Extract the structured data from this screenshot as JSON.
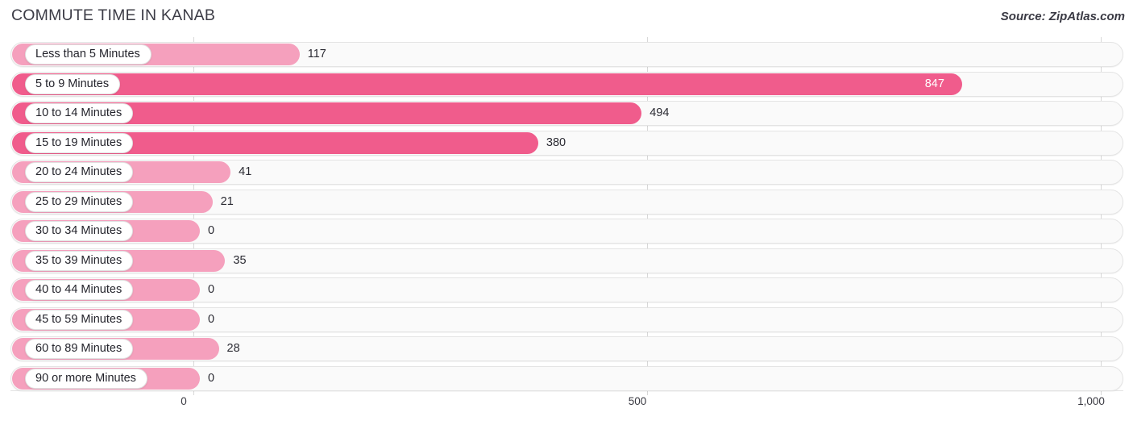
{
  "header": {
    "title": "COMMUTE TIME IN KANAB",
    "source": "Source: ZipAtlas.com"
  },
  "axis": {
    "ticks": [
      "0",
      "500",
      "1,000"
    ]
  },
  "colors": {
    "bar_light": "#f5a0bd",
    "bar_strong": "#f05c8c",
    "track": "#fafafa",
    "gridline": "#d8d8d8",
    "title_text": "#3c3c46"
  },
  "chart_data": {
    "type": "bar",
    "orientation": "horizontal",
    "title": "COMMUTE TIME IN KANAB",
    "xlabel": "",
    "ylabel": "",
    "xlim": [
      0,
      1000
    ],
    "xticks": [
      0,
      500,
      1000
    ],
    "grid": true,
    "legend": "none",
    "categories": [
      "Less than 5 Minutes",
      "5 to 9 Minutes",
      "10 to 14 Minutes",
      "15 to 19 Minutes",
      "20 to 24 Minutes",
      "25 to 29 Minutes",
      "30 to 34 Minutes",
      "35 to 39 Minutes",
      "40 to 44 Minutes",
      "45 to 59 Minutes",
      "60 to 89 Minutes",
      "90 or more Minutes"
    ],
    "values": [
      117,
      847,
      494,
      380,
      41,
      21,
      0,
      35,
      0,
      0,
      28,
      0
    ],
    "value_labels": [
      "117",
      "847",
      "494",
      "380",
      "41",
      "21",
      "0",
      "35",
      "0",
      "0",
      "28",
      "0"
    ]
  },
  "rows": [
    {
      "label": "Less than 5 Minutes",
      "value": 117,
      "value_label": "117",
      "tone": "light",
      "label_inside": false
    },
    {
      "label": "5 to 9 Minutes",
      "value": 847,
      "value_label": "847",
      "tone": "strong",
      "label_inside": true
    },
    {
      "label": "10 to 14 Minutes",
      "value": 494,
      "value_label": "494",
      "tone": "strong",
      "label_inside": false
    },
    {
      "label": "15 to 19 Minutes",
      "value": 380,
      "value_label": "380",
      "tone": "strong",
      "label_inside": false
    },
    {
      "label": "20 to 24 Minutes",
      "value": 41,
      "value_label": "41",
      "tone": "light",
      "label_inside": false
    },
    {
      "label": "25 to 29 Minutes",
      "value": 21,
      "value_label": "21",
      "tone": "light",
      "label_inside": false
    },
    {
      "label": "30 to 34 Minutes",
      "value": 0,
      "value_label": "0",
      "tone": "light",
      "label_inside": false
    },
    {
      "label": "35 to 39 Minutes",
      "value": 35,
      "value_label": "35",
      "tone": "light",
      "label_inside": false
    },
    {
      "label": "40 to 44 Minutes",
      "value": 0,
      "value_label": "0",
      "tone": "light",
      "label_inside": false
    },
    {
      "label": "45 to 59 Minutes",
      "value": 0,
      "value_label": "0",
      "tone": "light",
      "label_inside": false
    },
    {
      "label": "60 to 89 Minutes",
      "value": 28,
      "value_label": "28",
      "tone": "light",
      "label_inside": false
    },
    {
      "label": "90 or more Minutes",
      "value": 0,
      "value_label": "0",
      "tone": "light",
      "label_inside": false
    }
  ]
}
